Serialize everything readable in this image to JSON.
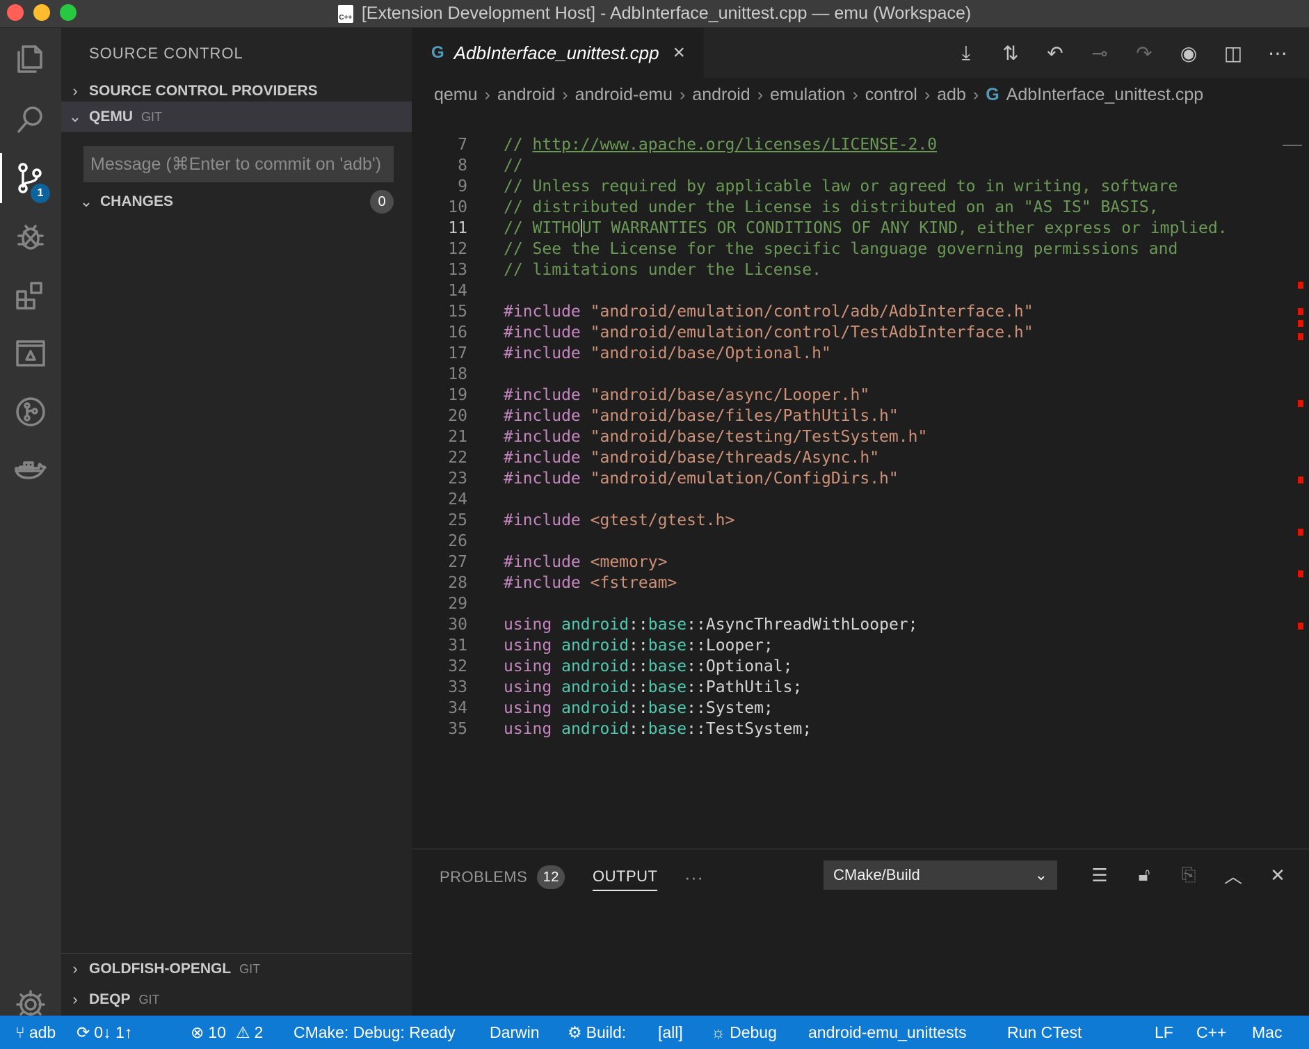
{
  "window": {
    "title": "[Extension Development Host] - AdbInterface_unittest.cpp — emu (Workspace)",
    "file_icon_text": "C++"
  },
  "activity_bar": {
    "scm_badge": "1"
  },
  "sidebar": {
    "title": "SOURCE CONTROL",
    "providers_label": "SOURCE CONTROL PROVIDERS",
    "repo_name": "QEMU",
    "repo_type": "GIT",
    "commit_placeholder": "Message (⌘Enter to commit on 'adb')",
    "changes_label": "CHANGES",
    "changes_count": "0",
    "bottom_repos": [
      {
        "name": "GOLDFISH-OPENGL",
        "type": "GIT"
      },
      {
        "name": "DEQP",
        "type": "GIT"
      }
    ]
  },
  "editor": {
    "tab_label": "AdbInterface_unittest.cpp",
    "tab_icon": "G",
    "breadcrumb": [
      "qemu",
      "android",
      "android-emu",
      "android",
      "emulation",
      "control",
      "adb"
    ],
    "breadcrumb_file": "AdbInterface_unittest.cpp",
    "partial_line": "//",
    "lines": {
      "7": {
        "num": "7",
        "a": "// ",
        "b": "http://www.apache.org/licenses/LICENSE-2.0"
      },
      "8": {
        "num": "8",
        "a": "//"
      },
      "9": {
        "num": "9",
        "a": "// Unless required by applicable law or agreed to in writing, software"
      },
      "10": {
        "num": "10",
        "a": "// distributed under the License is distributed on an \"AS IS\" BASIS,"
      },
      "11": {
        "num": "11",
        "a": "// WITHO",
        "b": "UT WARRANTIES OR CONDITIONS OF ANY KIND, either express or implied."
      },
      "12": {
        "num": "12",
        "a": "// See the License for the specific language governing permissions and"
      },
      "13": {
        "num": "13",
        "a": "// limitations under the License."
      },
      "14": {
        "num": "14"
      },
      "15": {
        "num": "15",
        "a": "#include",
        "b": "\"android/emulation/control/adb/AdbInterface.h\""
      },
      "16": {
        "num": "16",
        "a": "#include",
        "b": "\"android/emulation/control/TestAdbInterface.h\""
      },
      "17": {
        "num": "17",
        "a": "#include",
        "b": "\"android/base/Optional.h\""
      },
      "18": {
        "num": "18"
      },
      "19": {
        "num": "19",
        "a": "#include",
        "b": "\"android/base/async/Looper.h\""
      },
      "20": {
        "num": "20",
        "a": "#include",
        "b": "\"android/base/files/PathUtils.h\""
      },
      "21": {
        "num": "21",
        "a": "#include",
        "b": "\"android/base/testing/TestSystem.h\""
      },
      "22": {
        "num": "22",
        "a": "#include",
        "b": "\"android/base/threads/Async.h\""
      },
      "23": {
        "num": "23",
        "a": "#include",
        "b": "\"android/emulation/ConfigDirs.h\""
      },
      "24": {
        "num": "24"
      },
      "25": {
        "num": "25",
        "a": "#include",
        "b": "<gtest/gtest.h>"
      },
      "26": {
        "num": "26"
      },
      "27": {
        "num": "27",
        "a": "#include",
        "b": "<memory>"
      },
      "28": {
        "num": "28",
        "a": "#include",
        "b": "<fstream>"
      },
      "29": {
        "num": "29"
      },
      "30": {
        "num": "30",
        "a": "using",
        "ns1": "android",
        "ns2": "base",
        "b": "AsyncThreadWithLooper;"
      },
      "31": {
        "num": "31",
        "a": "using",
        "ns1": "android",
        "ns2": "base",
        "b": "Looper;"
      },
      "32": {
        "num": "32",
        "a": "using",
        "ns1": "android",
        "ns2": "base",
        "b": "Optional;"
      },
      "33": {
        "num": "33",
        "a": "using",
        "ns1": "android",
        "ns2": "base",
        "b": "PathUtils;"
      },
      "34": {
        "num": "34",
        "a": "using",
        "ns1": "android",
        "ns2": "base",
        "b": "System;"
      },
      "35": {
        "num": "35",
        "a": "using",
        "ns1": "android",
        "ns2": "base",
        "b": "TestSystem;"
      }
    },
    "scope_sep": "::"
  },
  "panel": {
    "problems_label": "PROBLEMS",
    "problems_count": "12",
    "output_label": "OUTPUT",
    "more": "···",
    "output_channel": "CMake/Build"
  },
  "statusbar": {
    "branch": "adb",
    "sync": "0↓ 1↑",
    "errors": "10",
    "warnings": "2",
    "cmake_status": "CMake: Debug: Ready",
    "platform": "Darwin",
    "build_label": "Build:",
    "build_target": "[all]",
    "debug_label": "Debug",
    "launch_target": "android-emu_unittests",
    "run_ctest": "Run CTest",
    "eol": "LF",
    "language": "C++",
    "platform_short": "Mac"
  },
  "colors": {
    "status_bar": "#0e7ad3",
    "comment": "#6a9955",
    "keyword": "#c586c0",
    "string": "#ce9178",
    "namespace": "#4ec9b0"
  }
}
